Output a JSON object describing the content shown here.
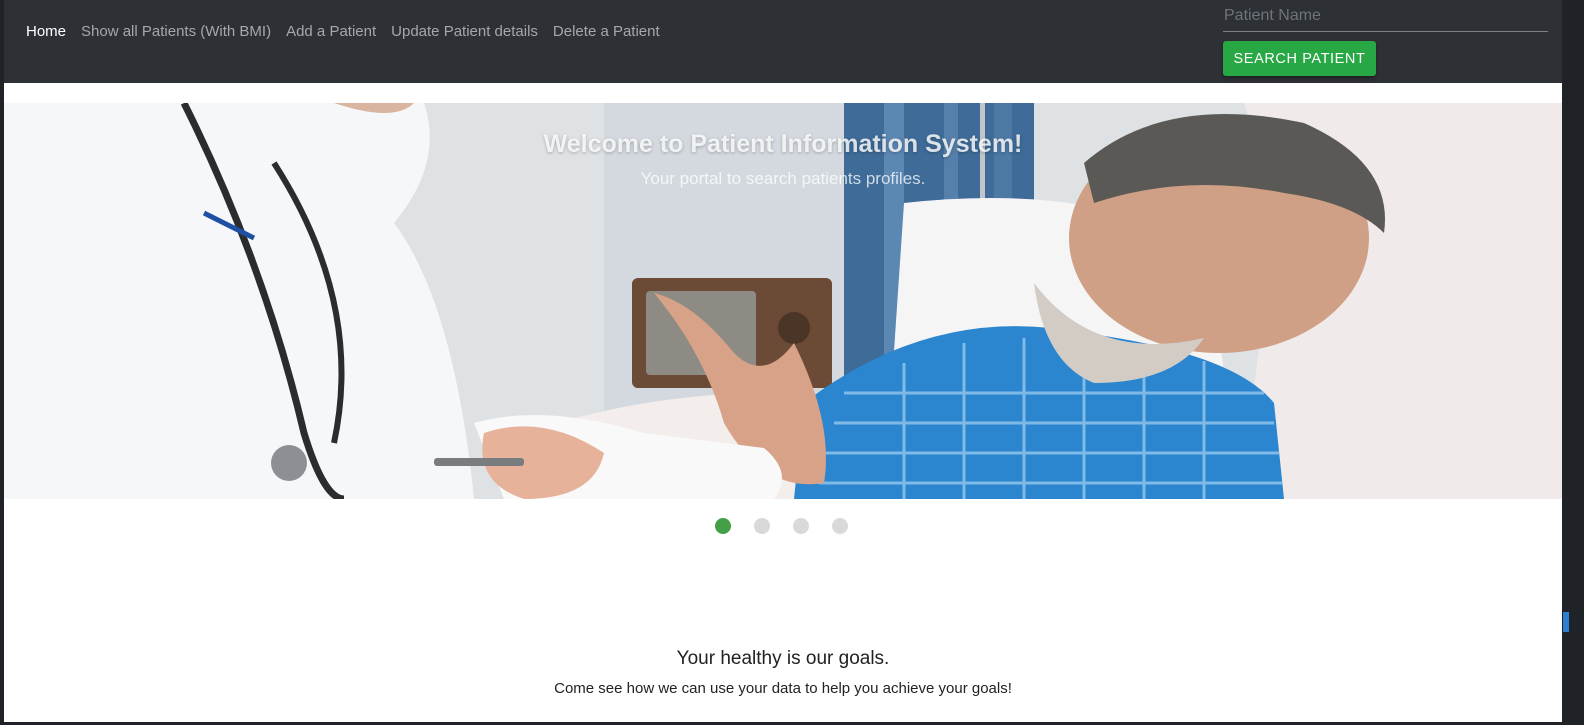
{
  "nav": {
    "links": [
      {
        "label": "Home",
        "active": true
      },
      {
        "label": "Show all Patients (With BMI)",
        "active": false
      },
      {
        "label": "Add a Patient",
        "active": false
      },
      {
        "label": "Update Patient details",
        "active": false
      },
      {
        "label": "Delete a Patient",
        "active": false
      }
    ]
  },
  "search": {
    "placeholder": "Patient Name",
    "value": "",
    "button_label": "SEARCH PATIENT"
  },
  "hero": {
    "title": "Welcome to Patient Information System!",
    "subtitle": "Your portal to search patients profiles.",
    "slide_count": 4,
    "active_slide": 1
  },
  "content": {
    "tagline": "Your healthy is our goals.",
    "tagline_sub": "Come see how we can use your data to help you achieve your goals!"
  },
  "colors": {
    "navbar": "#2d3035",
    "accent_green": "#28a745",
    "indicator_active": "#43a047",
    "indicator_inactive": "#d9d9d9"
  }
}
